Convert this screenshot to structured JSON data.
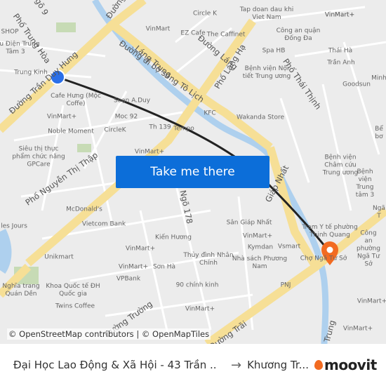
{
  "map": {
    "road_labels": [
      "Phố Trung Hòa",
      "Đường Trần Duy Hưng",
      "Láng Trung",
      "Đường đi bộ sông Tô Lịch",
      "Phố Láng Hạ",
      "Phố Thái Thịnh",
      "Phố Nguyễn Thị Thập",
      "Ngõ 178",
      "Giáp Nhất",
      "Đường",
      "Đường Trường",
      "Đường Trãi",
      "Đường Láng",
      "Trung",
      "Ngõ 9"
    ],
    "poi_labels": [
      "Circle K",
      "Tap doan dau khi Viet Nam",
      "VinMart",
      "EZ Cafe",
      "The Caffinet",
      "Công an quận Đống Đa",
      "VinMart+",
      "Spa HB",
      "Thái Hà",
      "Trần Anh",
      "Bệnh viện Nội tiết Trung ương",
      "Goodsun",
      "KFC",
      "Wakanda Store",
      "Cafe Hưng (Mộc Coffe)",
      "Soạn A.Duy",
      "Moc 92",
      "VinMart+",
      "Noble Moment",
      "CircleK",
      "Th 139",
      "Tempo",
      "Siêu thị thực phẩm chức năng GPCare",
      "VinMart+",
      "Bệnh viện Châm cứu Trung ương",
      "Bệnh viện Trung tâm 3",
      "Bể bơ",
      "McDonald's",
      "Vietcom Bank",
      "Sân Giáp Nhất",
      "Trạm Y tế phường Thịnh Quang",
      "Kiến Hương",
      "VinMart+",
      "Kymdan",
      "Vsmart",
      "Unikmart",
      "VinMart+",
      "Thủy đình Nhân Chính",
      "Nhà sách Phương Nam",
      "Sơn Hà",
      "VinMart+",
      "VPBank",
      "90 chính kinh",
      "PNJ",
      "Chợ Ngã Tư Sở",
      "Công an phường Ngã Tư Sở",
      "Nghĩa trang Quán Dền",
      "Khoa Quốc tế ĐH Quốc gia",
      "Twins Coffee",
      "VinMart+",
      "VinMart+",
      "VinMart+",
      "SHOP",
      "Bưu Điện Trung Tâm 3",
      "Trung Kinh",
      "les Jours",
      "Ngã T",
      "VinMart+",
      "Minh"
    ],
    "attribution": "© OpenStreetMap contributors | © OpenMapTiles",
    "origin_marker_color": "#2b6fe8",
    "destination_marker_color": "#f26b21",
    "route_color": "#222222"
  },
  "cta": {
    "label": "Take me there",
    "color": "#0c6ed9"
  },
  "footer": {
    "from": "Đại Học Lao Động & Xã Hội - 43 Trần ...",
    "arrow": "→",
    "to": "Khương Tr...",
    "brand": "moovit",
    "brand_color": "#f26b21"
  }
}
